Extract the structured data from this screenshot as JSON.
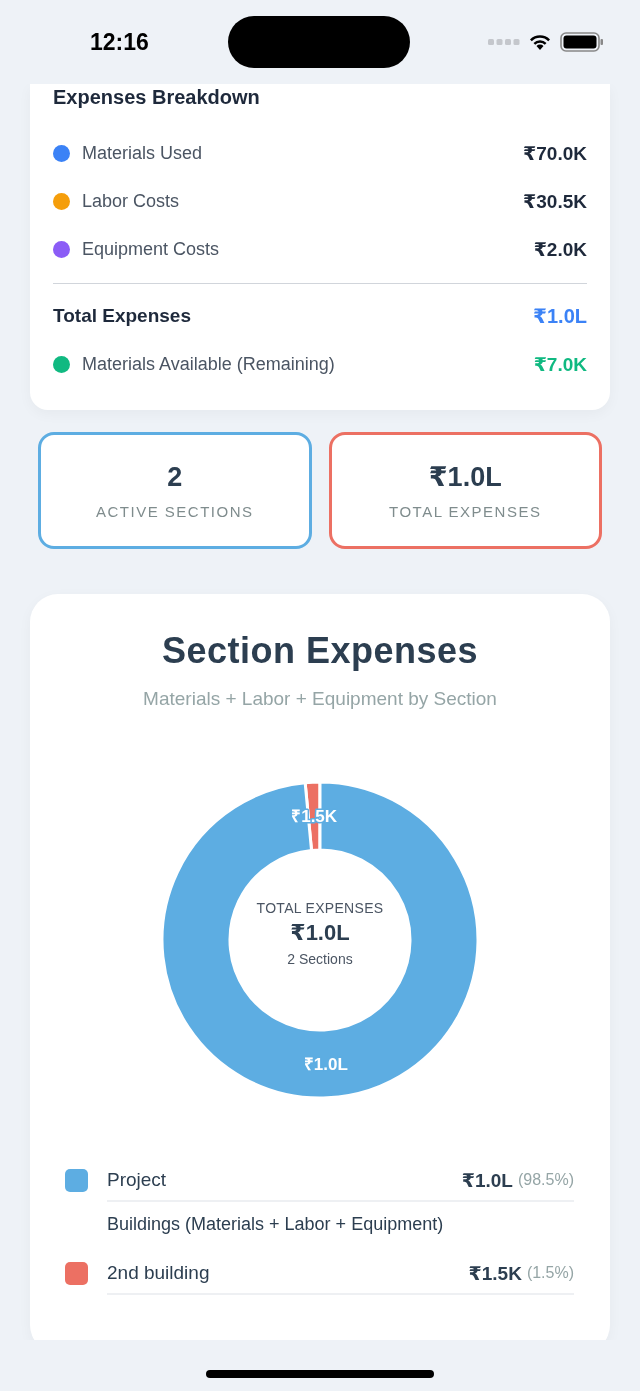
{
  "status_bar": {
    "time": "12:16"
  },
  "breakdown": {
    "title": "Expenses Breakdown",
    "items": [
      {
        "label": "Materials Used",
        "value": "₹70.0K",
        "color": "#3b82f6"
      },
      {
        "label": "Labor Costs",
        "value": "₹30.5K",
        "color": "#f59e0b"
      },
      {
        "label": "Equipment Costs",
        "value": "₹2.0K",
        "color": "#8b5cf6"
      }
    ],
    "total": {
      "label": "Total Expenses",
      "value": "₹1.0L"
    },
    "remaining": {
      "label": "Materials Available (Remaining)",
      "value": "₹7.0K",
      "color": "#10b981"
    }
  },
  "stats": [
    {
      "value": "2",
      "label": "ACTIVE SECTIONS",
      "color": "#5dade2"
    },
    {
      "value": "₹1.0L",
      "label": "TOTAL EXPENSES",
      "color": "#ec7063"
    }
  ],
  "section_expenses": {
    "title": "Section Expenses",
    "subtitle": "Materials + Labor + Equipment by Section",
    "center": {
      "label": "TOTAL EXPENSES",
      "value": "₹1.0L",
      "count": "2 Sections"
    },
    "chart_data": {
      "type": "donut",
      "categories": [
        "Project",
        "2nd building"
      ],
      "values": [
        98.5,
        1.5
      ]
    },
    "slice_labels": [
      "₹1.0L",
      "₹1.5K"
    ],
    "legend": [
      {
        "amount": "₹1.0L",
        "percent": "(98.5%)",
        "color": "#5dade2",
        "detail": "Buildings (Materials + Labor + Equipment)"
      },
      {
        "amount": "₹1.5K",
        "percent": "(1.5%)",
        "color": "#ec7063"
      }
    ]
  }
}
